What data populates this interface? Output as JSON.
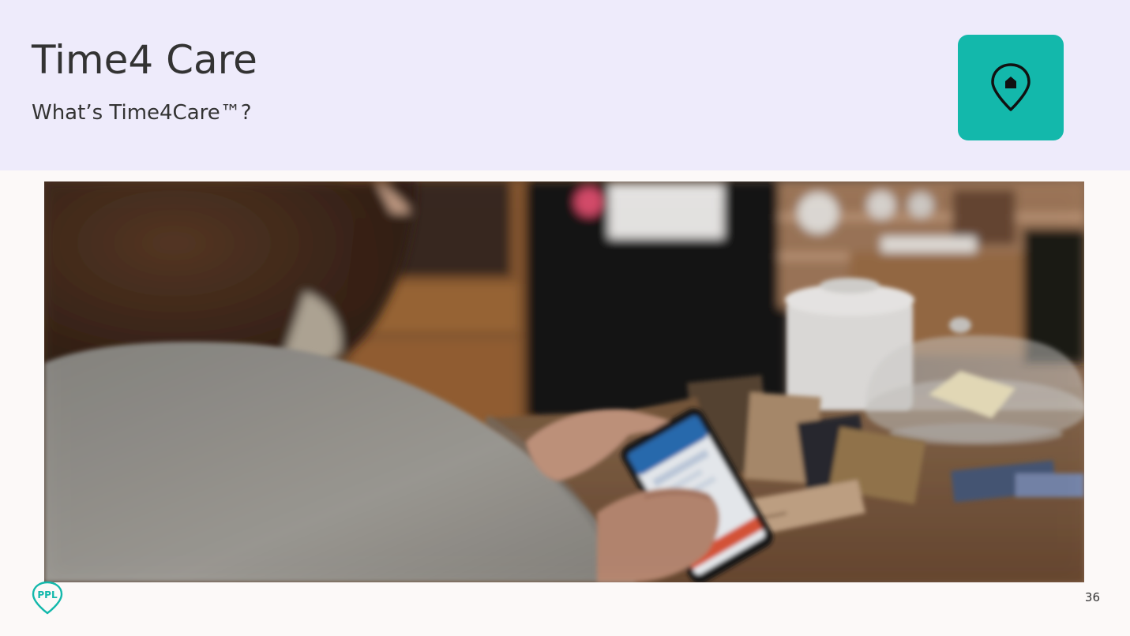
{
  "slide": {
    "title": "Time4 Care",
    "subtitle": "What’s Time4Care™?",
    "page_number": "36"
  },
  "home_button": {
    "icon": "home-location-pin-icon",
    "color": "#13b8ab"
  },
  "photo": {
    "description_icon": "photo-woman-using-phone-app"
  },
  "logo": {
    "icon": "ppl-logo-pin",
    "text": "PPL",
    "color": "#13b8ab"
  },
  "colors": {
    "header_bg": "#eeebfb",
    "page_bg": "#fcf9f8",
    "accent": "#13b8ab",
    "text": "#333333"
  }
}
